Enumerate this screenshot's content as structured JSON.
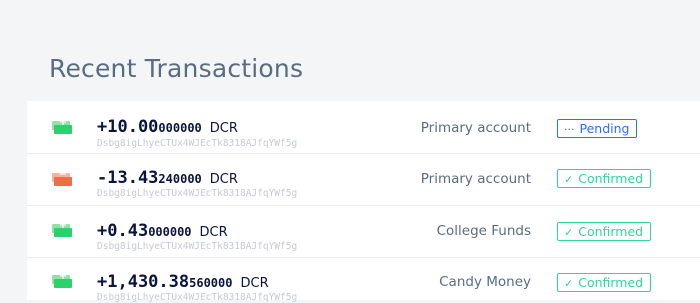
{
  "page": {
    "title": "Recent Transactions"
  },
  "transactions": [
    {
      "direction": "in",
      "icon": "wallet-receive-icon",
      "amount_main": "+10.00",
      "amount_fraction": "000000",
      "unit": "DCR",
      "address": "Dsbg8igLhyeCTUx4WJEcTk8318AJfqYWf5g",
      "account": "Primary account",
      "status": "Pending",
      "status_icon": "···",
      "status_type": "pending"
    },
    {
      "direction": "out",
      "icon": "wallet-send-icon",
      "amount_main": "-13.43",
      "amount_fraction": "240000",
      "unit": "DCR",
      "address": "Dsbg8igLhyeCTUx4WJEcTk8318AJfqYWf5g",
      "account": "Primary account",
      "status": "Confirmed",
      "status_icon": "✓",
      "status_type": "confirmed"
    },
    {
      "direction": "in",
      "icon": "wallet-receive-icon",
      "amount_main": "+0.43",
      "amount_fraction": "000000",
      "unit": "DCR",
      "address": "Dsbg8igLhyeCTUx4WJEcTk8318AJfqYWf5g",
      "account": "College Funds",
      "status": "Confirmed",
      "status_icon": "✓",
      "status_type": "confirmed"
    },
    {
      "direction": "in",
      "icon": "wallet-receive-icon",
      "amount_main": "+1,430.38",
      "amount_fraction": "560000",
      "unit": "DCR",
      "address": "Dsbg8igLhyeCTUx4WJEcTk8318AJfqYWf5g",
      "account": "Candy Money",
      "status": "Confirmed",
      "status_icon": "✓",
      "status_type": "confirmed"
    }
  ],
  "colors": {
    "title": "#596d81",
    "amount": "#091440",
    "pending": "#2970ff",
    "confirmed": "#2ed6a1",
    "receive": "#2ed06e",
    "send": "#ed6d47"
  }
}
